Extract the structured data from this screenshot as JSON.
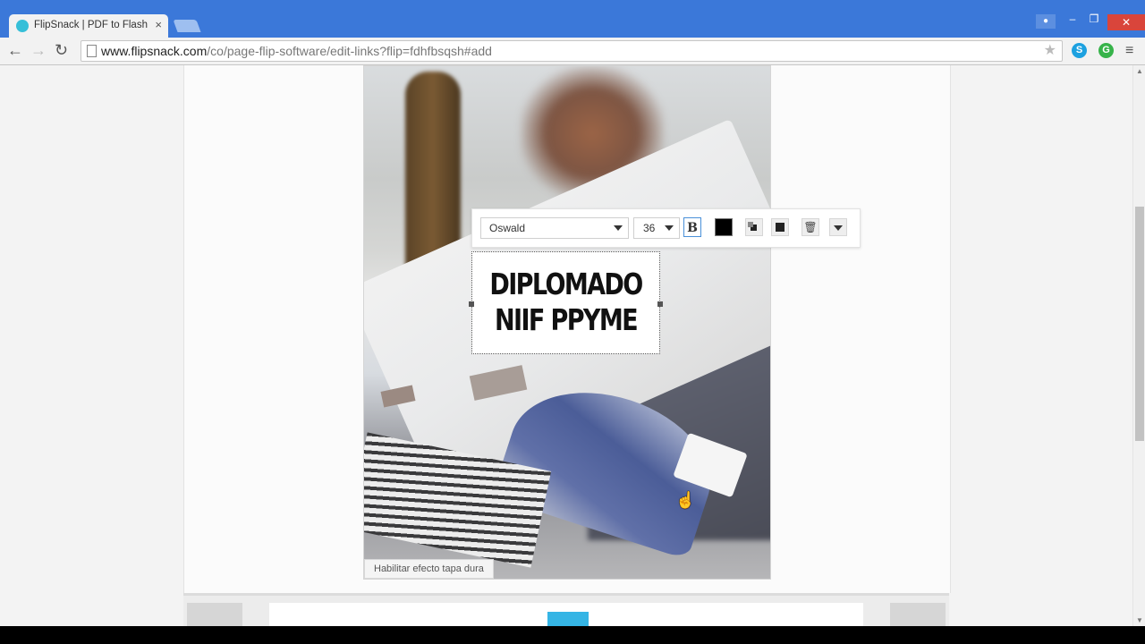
{
  "browser": {
    "tab_title": "FlipSnack | PDF to Flash p",
    "tab_close": "×",
    "url_host": "www.flipsnack.com",
    "url_path": "/co/page-flip-software/edit-links?flip=fdhfbsqsh#add",
    "icons": [
      "back-icon",
      "forward-icon",
      "reload-icon",
      "page-icon",
      "star-icon",
      "skype-icon",
      "grammarly-icon",
      "menu-icon"
    ]
  },
  "window_controls": {
    "min": "–",
    "max": "❐",
    "close": "✕"
  },
  "editor": {
    "text_line_1": "DIPLOMADO",
    "text_line_2": "NIIF PPYME",
    "font_family_value": "Oswald",
    "font_size_value": "36",
    "bold_label": "B",
    "text_color": "#000000",
    "trash_glyph": "🗑",
    "hardcover_label": "Habilitar efecto tapa dura"
  },
  "colors": {
    "chrome_blue": "#3b78d9",
    "accent_cyan": "#35b5e5"
  }
}
